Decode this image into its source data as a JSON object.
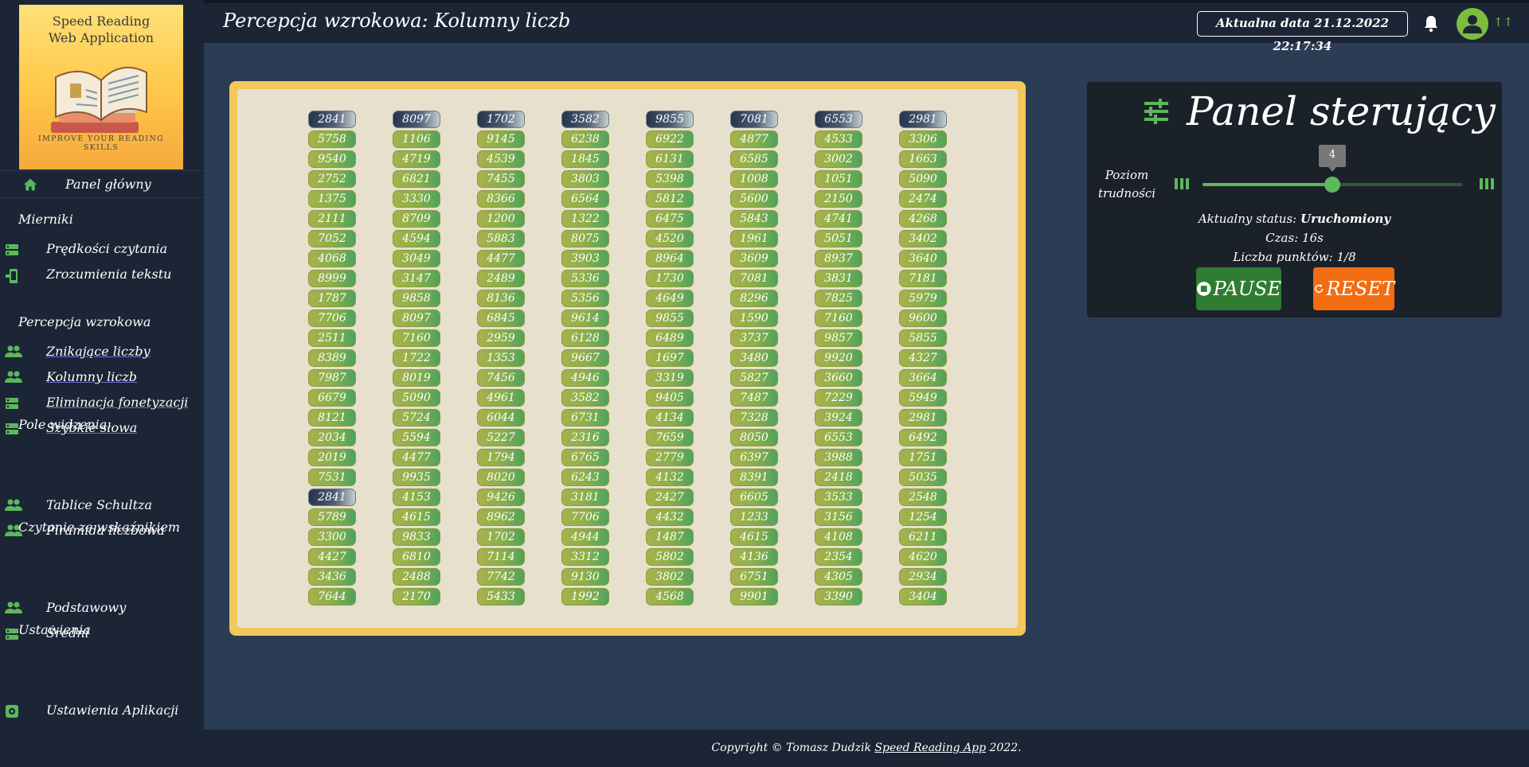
{
  "sidebar": {
    "logo": {
      "line1": "Speed Reading",
      "line2": "Web Application",
      "tagline": "IMPROVE YOUR READING SKILLS"
    },
    "home": {
      "label": "Panel główny",
      "icon": "home-icon"
    },
    "sections": [
      {
        "title": "Mierniki",
        "items": [
          {
            "label": "Prędkości czytania",
            "icon": "dns-icon"
          },
          {
            "label": "Zrozumienia tekstu",
            "icon": "phonelink-icon"
          }
        ]
      },
      {
        "title": "Percepcja wzrokowa",
        "items": [
          {
            "label": "Znikające liczby",
            "icon": "people-icon"
          },
          {
            "label": "Kolumny liczb",
            "icon": "people-icon"
          },
          {
            "label": "Eliminacja fonetyzacji",
            "icon": "dns-icon"
          },
          {
            "label": "Szybkie słowa",
            "icon": "dns-icon"
          }
        ]
      },
      {
        "title": "Pole widzenia",
        "items": [
          {
            "label": "Tablice Schultza",
            "icon": "people-icon"
          },
          {
            "label": "Piramida liczbowa",
            "icon": "people-icon"
          }
        ]
      },
      {
        "title": "Czytanie ze wskaźnikiem",
        "items": [
          {
            "label": "Podstawowy",
            "icon": "people-icon"
          },
          {
            "label": "Średni",
            "icon": "dns-icon"
          }
        ]
      },
      {
        "title": "Ustawienia",
        "items": [
          {
            "label": "Ustawienia Aplikacji",
            "icon": "settings-icon"
          }
        ]
      }
    ]
  },
  "header": {
    "title": "Percepcja wzrokowa: Kolumny liczb",
    "date": "Aktualna data 21.12.2022 22:17:34",
    "user_marks": "↑↑"
  },
  "board": {
    "columns": [
      [
        "2841",
        "5758",
        "9540",
        "2752",
        "1375",
        "2111",
        "7052",
        "4068",
        "8999",
        "1787",
        "7706",
        "2511",
        "8389",
        "7987",
        "6679",
        "8121",
        "2034",
        "2019",
        "7531",
        "2841",
        "5789",
        "3300",
        "4427",
        "3436",
        "7644"
      ],
      [
        "8097",
        "1106",
        "4719",
        "6821",
        "3330",
        "8709",
        "4594",
        "3049",
        "3147",
        "9858",
        "8097",
        "7160",
        "1722",
        "8019",
        "5090",
        "5724",
        "5594",
        "4477",
        "9935",
        "4153",
        "4615",
        "9833",
        "6810",
        "2488",
        "2170"
      ],
      [
        "1702",
        "9145",
        "4539",
        "7455",
        "8366",
        "1200",
        "5883",
        "4477",
        "2489",
        "8136",
        "6845",
        "2959",
        "1353",
        "7456",
        "4961",
        "6044",
        "5227",
        "1794",
        "8020",
        "9426",
        "8962",
        "1702",
        "7114",
        "7742",
        "5433"
      ],
      [
        "3582",
        "6238",
        "1845",
        "3803",
        "6564",
        "1322",
        "8075",
        "3903",
        "5336",
        "5356",
        "9614",
        "6128",
        "9667",
        "4946",
        "3582",
        "6731",
        "2316",
        "6765",
        "6243",
        "3181",
        "7706",
        "4944",
        "3312",
        "9130",
        "1992"
      ],
      [
        "9855",
        "6922",
        "6131",
        "5398",
        "5812",
        "6475",
        "4520",
        "8964",
        "1730",
        "4649",
        "9855",
        "6489",
        "1697",
        "3319",
        "9405",
        "4134",
        "7659",
        "2779",
        "4132",
        "2427",
        "4432",
        "1487",
        "5802",
        "3802",
        "4568"
      ],
      [
        "7081",
        "4877",
        "6585",
        "1008",
        "5600",
        "5843",
        "1961",
        "3609",
        "7081",
        "8296",
        "1590",
        "3737",
        "3480",
        "5827",
        "7487",
        "7328",
        "8050",
        "6397",
        "8391",
        "6605",
        "1233",
        "4615",
        "4136",
        "6751",
        "9901"
      ],
      [
        "6553",
        "4533",
        "3002",
        "1051",
        "2150",
        "4741",
        "5051",
        "8937",
        "3831",
        "7825",
        "7160",
        "9857",
        "9920",
        "3660",
        "7229",
        "3924",
        "6553",
        "3988",
        "2418",
        "3533",
        "3156",
        "4108",
        "2354",
        "4305",
        "3390"
      ],
      [
        "2981",
        "3306",
        "1663",
        "5090",
        "2474",
        "4268",
        "3402",
        "3640",
        "7181",
        "5979",
        "9600",
        "5855",
        "4327",
        "3664",
        "5949",
        "2981",
        "6492",
        "1751",
        "5035",
        "2548",
        "1254",
        "6211",
        "4620",
        "2934",
        "3404"
      ]
    ],
    "highlighted": [
      [
        0,
        0
      ],
      [
        1,
        0
      ],
      [
        2,
        0
      ],
      [
        3,
        0
      ],
      [
        4,
        0
      ],
      [
        5,
        0
      ],
      [
        6,
        0
      ],
      [
        7,
        0
      ],
      [
        0,
        19
      ]
    ],
    "colors": {
      "frame": "#f2c75c",
      "inner": "#e6e0cd",
      "cell_green": "#8cb04a",
      "cell_highlight": "#27344e"
    }
  },
  "panel": {
    "title": "Panel sterujący",
    "level_label": "Poziom trudności",
    "level_value": "4",
    "level_fraction": 0.5,
    "status_label": "Aktualny status:",
    "status_value": "Uruchomiony",
    "time_label": "Czas:",
    "time_value": "16s",
    "points_label": "Liczba punktów:",
    "points_value": "1/8",
    "pause_label": "PAUSE",
    "reset_label": "RESET",
    "colors": {
      "pause": "#2f7d32",
      "reset": "#f26c12",
      "slider": "#5cb85c"
    }
  },
  "footer": {
    "prefix": "Copyright © Tomasz Dudzik ",
    "link": "Speed Reading App",
    "suffix": " 2022."
  }
}
